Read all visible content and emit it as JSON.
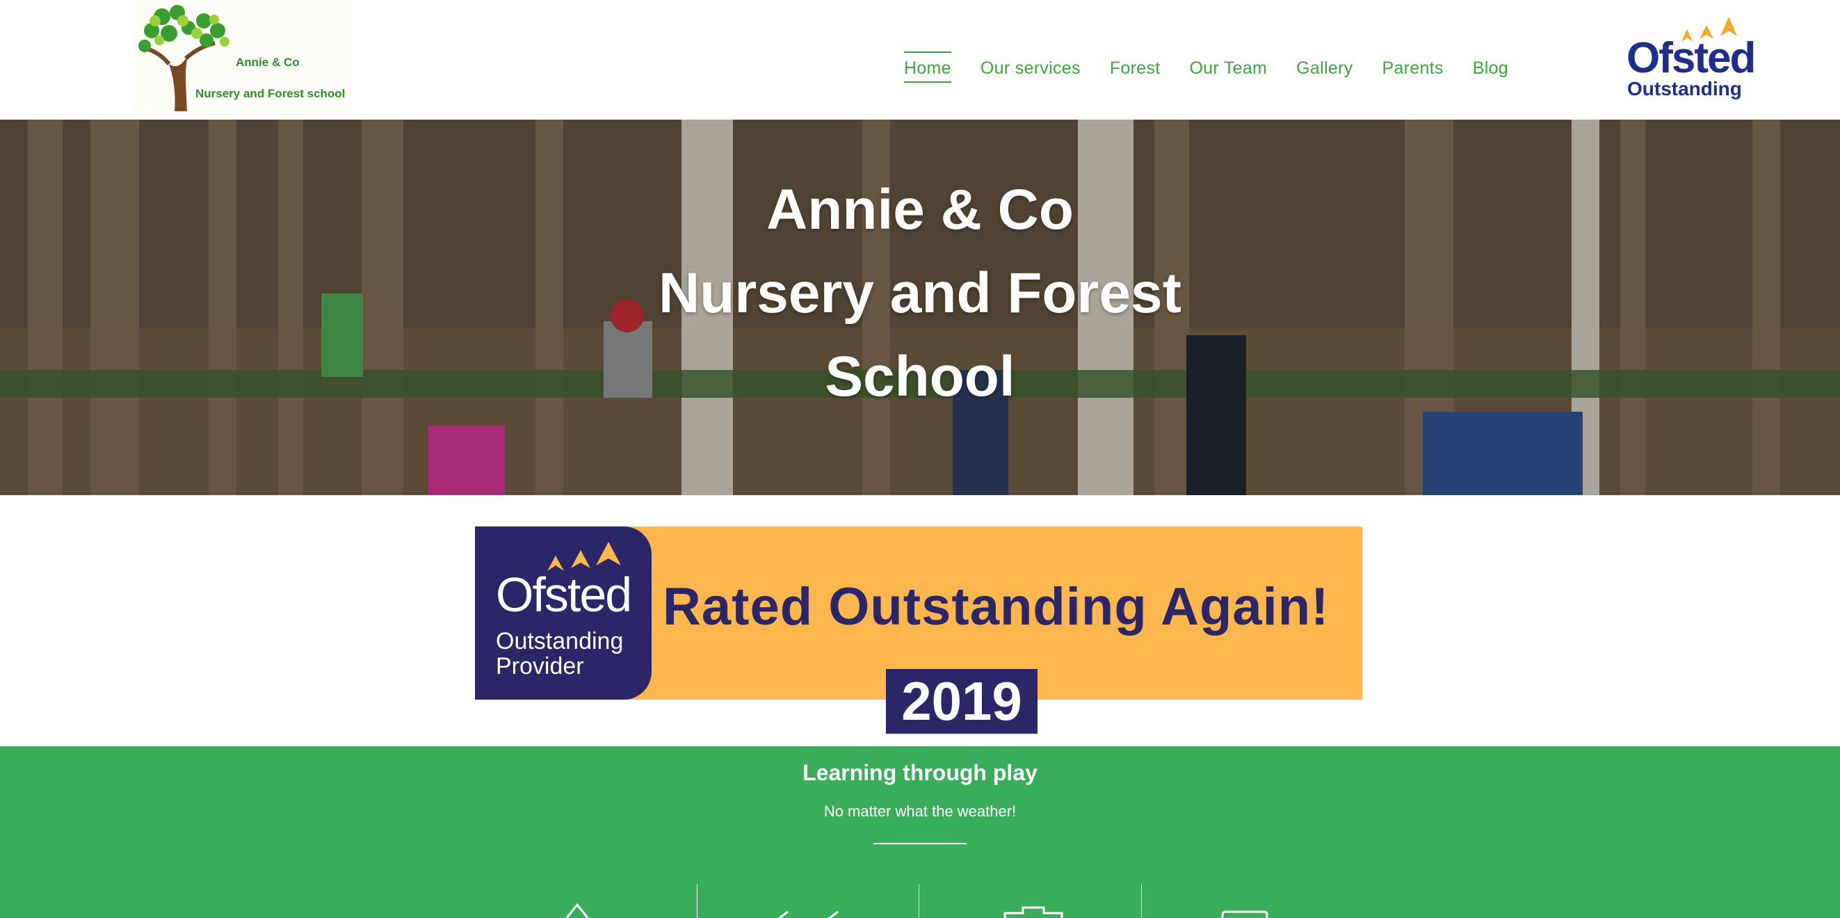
{
  "header": {
    "logo": {
      "line1": "Annie & Co",
      "line2": "Nursery and Forest school"
    },
    "nav": [
      {
        "label": "Home",
        "active": true
      },
      {
        "label": "Our services",
        "active": false
      },
      {
        "label": "Forest",
        "active": false
      },
      {
        "label": "Our Team",
        "active": false
      },
      {
        "label": "Gallery",
        "active": false
      },
      {
        "label": "Parents",
        "active": false
      },
      {
        "label": "Blog",
        "active": false
      }
    ],
    "ofsted_badge": {
      "word": "Ofsted",
      "sub": "Outstanding"
    }
  },
  "hero": {
    "title_line1": "Annie & Co",
    "title_line2": "Nursery and Forest",
    "title_line3": "School"
  },
  "banner": {
    "ofsted": "Ofsted",
    "provider_line1": "Outstanding",
    "provider_line2": "Provider",
    "headline": "Rated Outstanding Again!",
    "year": "2019"
  },
  "section": {
    "title": "Learning through play",
    "subtitle": "No matter what the weather!"
  },
  "colors": {
    "brand_green": "#3aa83a",
    "section_green": "#3aad5a",
    "ofsted_navy": "#1d2f8a",
    "banner_orange": "#fdb74e",
    "banner_navy": "#2b2667"
  }
}
